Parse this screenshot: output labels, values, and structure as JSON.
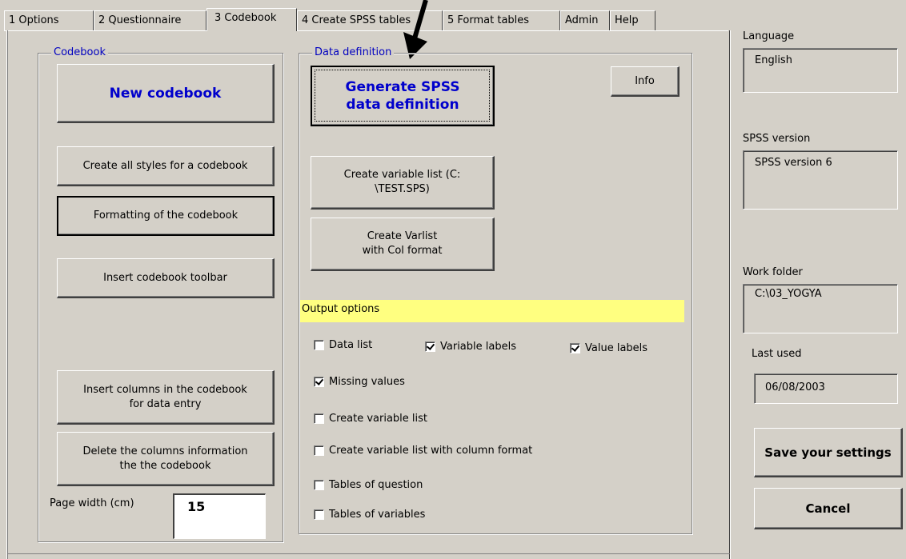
{
  "tabs": [
    {
      "label": "1 Options"
    },
    {
      "label": "2 Questionnaire"
    },
    {
      "label": "3 Codebook"
    },
    {
      "label": "4 Create SPSS tables"
    },
    {
      "label": "5 Format tables"
    },
    {
      "label": "Admin"
    },
    {
      "label": "Help"
    }
  ],
  "codebook": {
    "title": "Codebook",
    "new_codebook": "New codebook",
    "create_styles": "Create all styles for a codebook",
    "formatting": "Formatting of the codebook",
    "insert_toolbar": "Insert codebook toolbar",
    "insert_columns": "Insert columns in the codebook\nfor data entry",
    "delete_columns": "Delete the columns information\nthe the codebook",
    "page_width_label": "Page width (cm)",
    "page_width_value": "15"
  },
  "data_definition": {
    "title": "Data definition",
    "generate": "Generate SPSS\ndata definition",
    "info": "Info",
    "create_varlist": "Create variable list (C:\n\\TEST.SPS)",
    "create_varlist_col": "Create Varlist\nwith Col format",
    "output_options": "Output options",
    "checks": {
      "data_list": {
        "label": "Data list",
        "checked": false
      },
      "variable_labels": {
        "label": "Variable labels",
        "checked": true
      },
      "value_labels": {
        "label": "Value labels",
        "checked": true
      },
      "missing_values": {
        "label": "Missing values",
        "checked": true
      },
      "create_variable_list": {
        "label": "Create variable list",
        "checked": false
      },
      "create_variable_list_col": {
        "label": "Create variable list with column format",
        "checked": false
      },
      "tables_of_question": {
        "label": "Tables of question",
        "checked": false
      },
      "tables_of_variables": {
        "label": "Tables of variables",
        "checked": false
      }
    }
  },
  "settings": {
    "language_label": "Language",
    "language_value": "English",
    "spss_version_label": "SPSS version",
    "spss_version_value": "SPSS version 6",
    "work_folder_label": "Work folder",
    "work_folder_value": "C:\\03_YOGYA",
    "last_used_label": "Last used",
    "last_used_value": "06/08/2003",
    "save": "Save your settings",
    "cancel": "Cancel"
  },
  "colors": {
    "background": "#d4d0c8",
    "frame_title": "#0000c0",
    "highlight_bar": "#ffff80"
  }
}
